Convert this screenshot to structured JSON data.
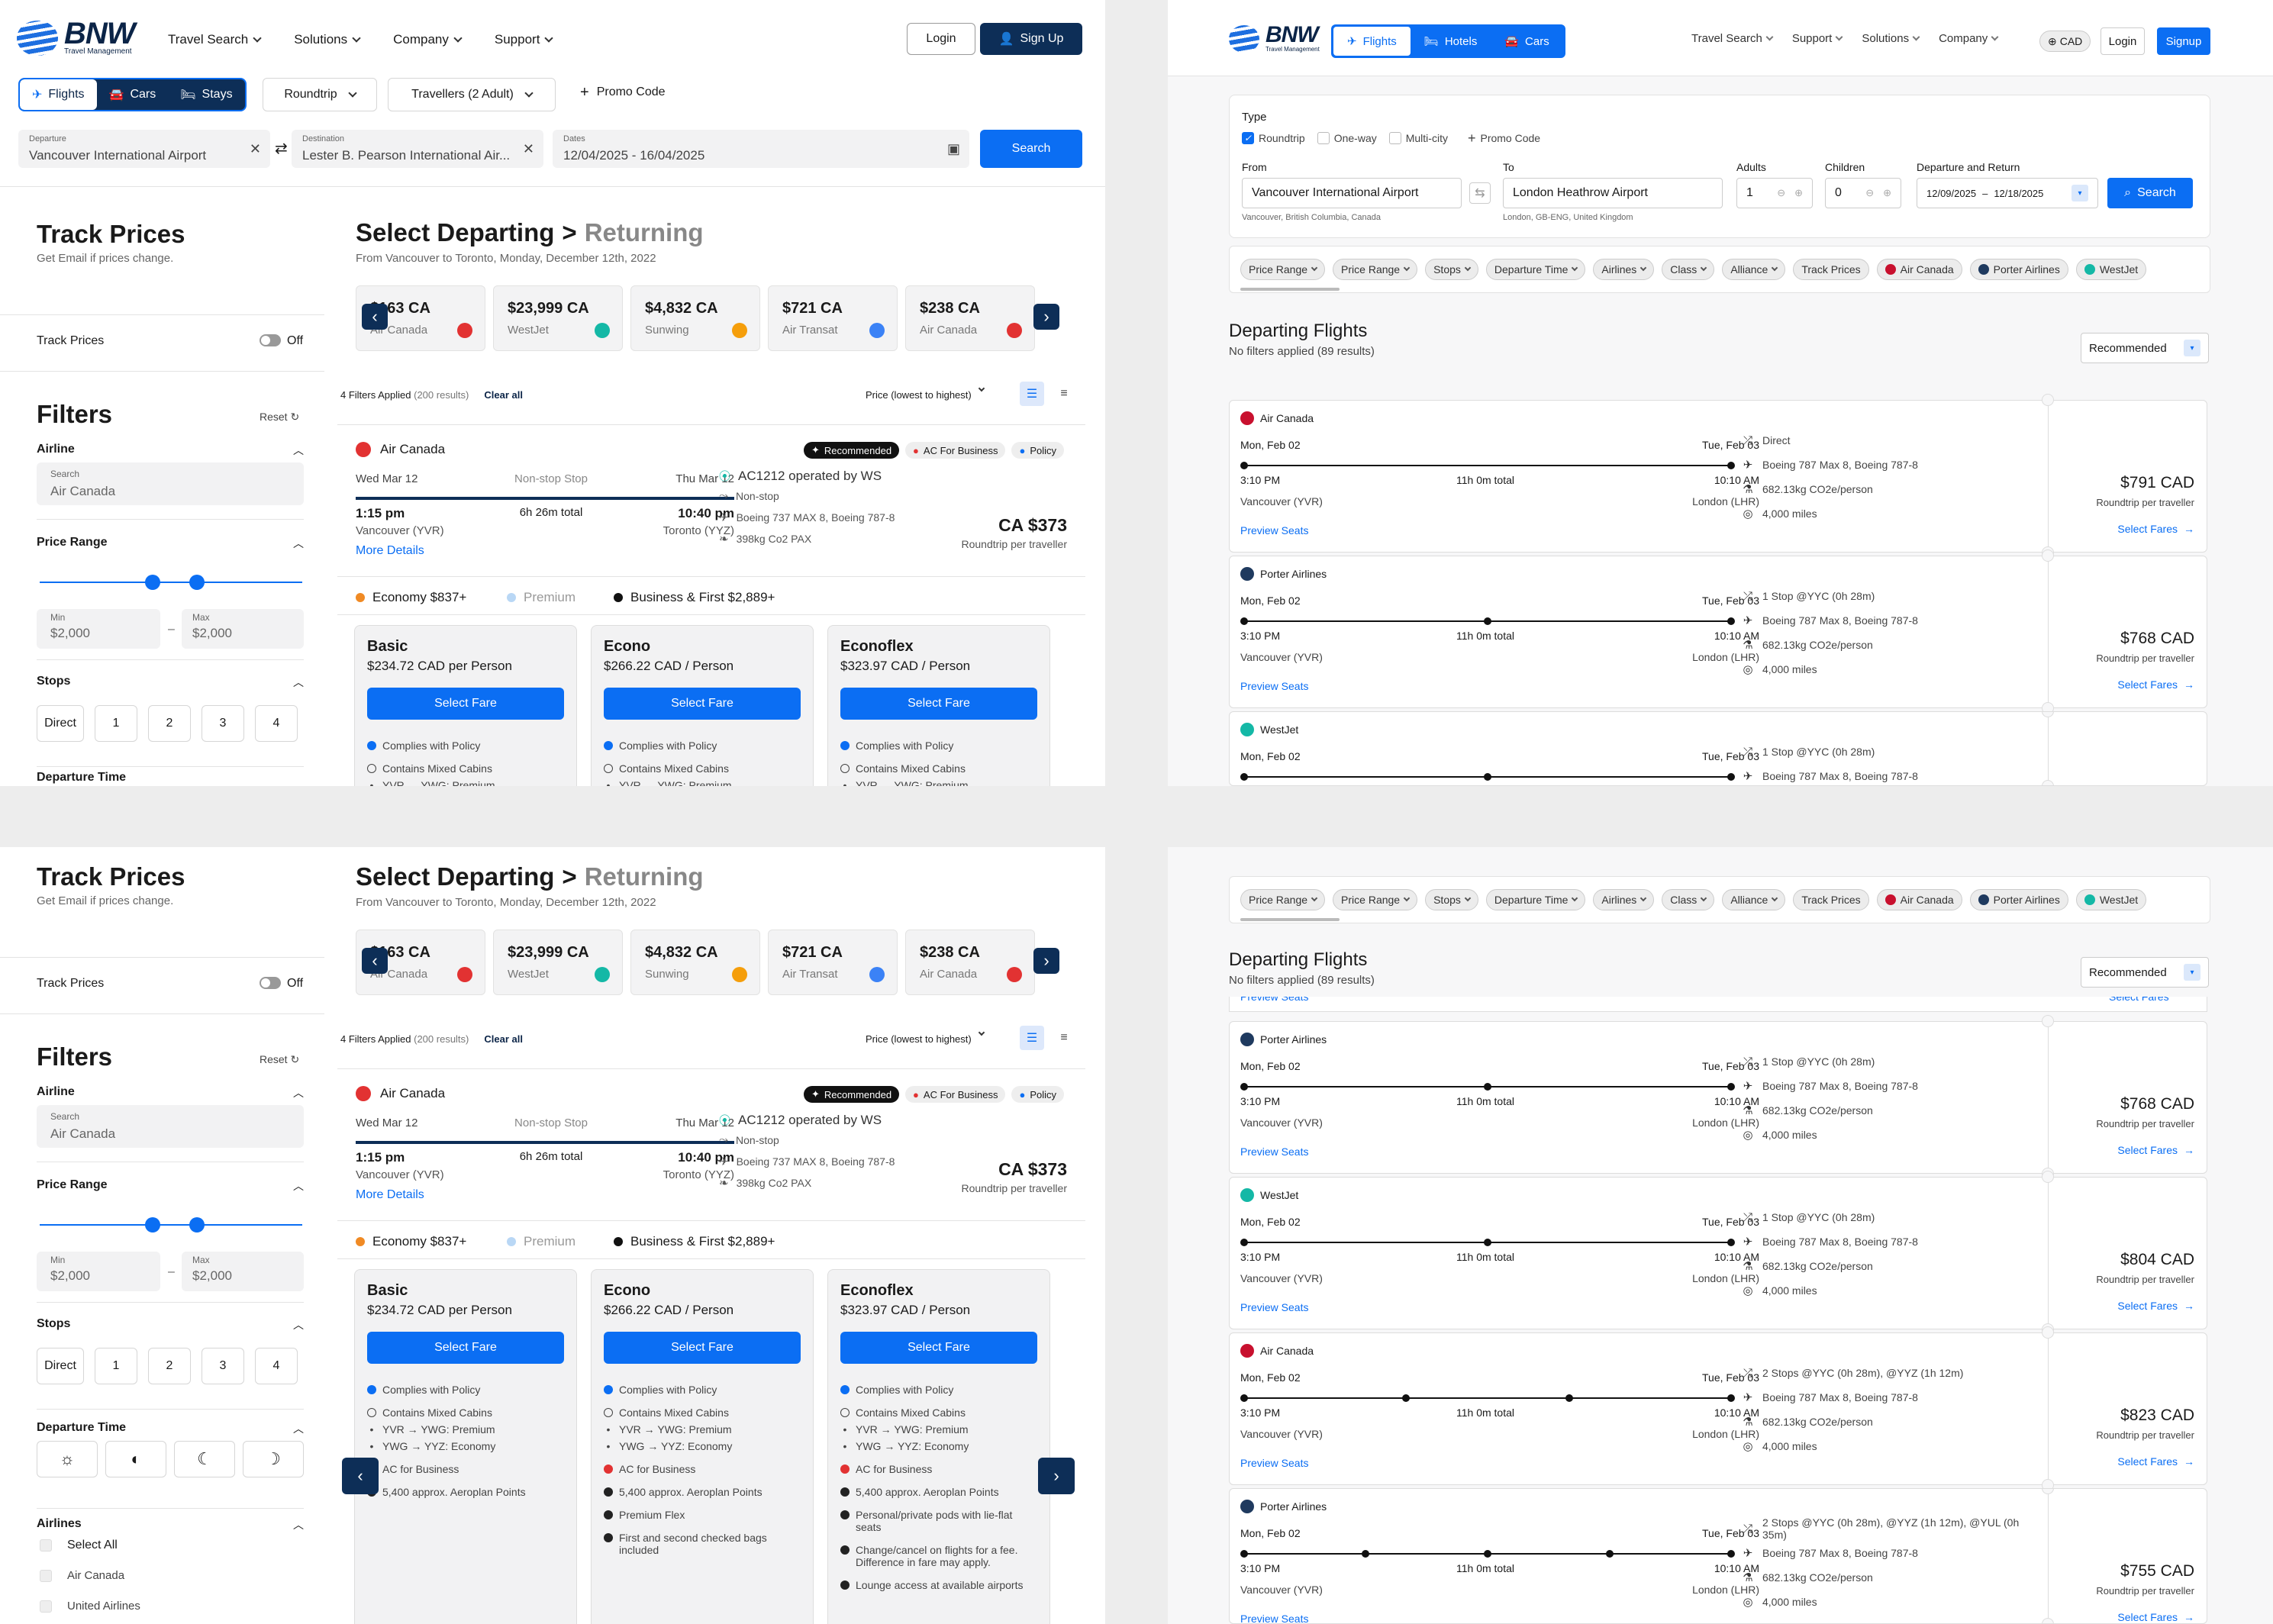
{
  "brand": {
    "name": "BNW",
    "sub": "Travel Management"
  },
  "left": {
    "nav": [
      "Travel Search",
      "Solutions",
      "Company",
      "Support"
    ],
    "login": "Login",
    "signup": "Sign Up",
    "modes": [
      "Flights",
      "Cars",
      "Stays"
    ],
    "trip_type": "Roundtrip",
    "travellers": "Travellers (2 Adult)",
    "promo": "Promo Code",
    "departure_label": "Departure",
    "departure": "Vancouver International Airport",
    "destination_label": "Destination",
    "destination": "Lester B. Pearson International Air...",
    "dates_label": "Dates",
    "dates": "12/04/2025 - 16/04/2025",
    "search": "Search",
    "track": {
      "title": "Track Prices",
      "sub": "Get Email if prices change.",
      "toggle_label": "Track Prices",
      "toggle_state": "Off"
    },
    "filters": {
      "title": "Filters",
      "reset": "Reset",
      "airline": "Airline",
      "search_label": "Search",
      "search_value": "Air Canada",
      "price_range": "Price Range",
      "min_label": "Min",
      "min": "$2,000",
      "max_label": "Max",
      "max": "$2,000",
      "stops": "Stops",
      "stop_opts": [
        "Direct",
        "1",
        "2",
        "3",
        "4"
      ],
      "departure_time": "Departure Time",
      "airlines": "Airlines",
      "airline_opts": [
        "Select All",
        "Air Canada",
        "United Airlines"
      ]
    },
    "heading": {
      "select": "Select Departing",
      "sep": ">",
      "returning": "Returning",
      "sub": "From Vancouver to Toronto, Monday, December 12th, 2022"
    },
    "price_cards": [
      {
        "price": "$163 CA",
        "airline": "Air Canada",
        "color": "#e23232"
      },
      {
        "price": "$23,999 CA",
        "airline": "WestJet",
        "color": "#14b8a6"
      },
      {
        "price": "$4,832 CA",
        "airline": "Sunwing",
        "color": "#f59e0b"
      },
      {
        "price": "$721 CA",
        "airline": "Air Transat",
        "color": "#3b82f6"
      },
      {
        "price": "$238 CA",
        "airline": "Air Canada",
        "color": "#e23232"
      }
    ],
    "results": {
      "applied": "4 Filters Applied",
      "count": "(200 results)",
      "clear": "Clear all",
      "sort": "Price (lowest to highest)"
    },
    "card": {
      "airline": "Air Canada",
      "badges": [
        "Recommended",
        "AC For Business",
        "Policy"
      ],
      "dep_date": "Wed Mar 12",
      "stop_type": "Non-stop Stop",
      "arr_date": "Thu Mar 12",
      "dep_time": "1:15 pm",
      "duration": "6h 26m total",
      "arr_time": "10:40 pm",
      "dep_place": "Vancouver (YVR)",
      "arr_place": "Toronto (YYZ)",
      "more": "More Details",
      "operated": "AC1212 operated by WS",
      "nonstop": "Non-stop",
      "aircraft": "Boeing 737 MAX 8, Boeing 787-8",
      "co2": "398kg Co2 PAX",
      "price": "CA $373",
      "price_sub": "Roundtrip per traveller",
      "cabins": [
        {
          "label": "Economy $837+",
          "color": "#f08a24"
        },
        {
          "label": "Premium",
          "color": "#b9d7f5"
        },
        {
          "label": "Business & First $2,889+",
          "color": "#111"
        }
      ]
    },
    "fares": [
      {
        "name": "Basic",
        "price": "$234.72 CAD per Person",
        "btn": "Select Fare",
        "items": [
          {
            "t": "Complies with Policy",
            "c": "#0b6ef3"
          },
          {
            "t": "Contains Mixed Cabins",
            "c": "#fff"
          },
          {
            "t": "YVR → YWG: Premium",
            "c": "none"
          },
          {
            "t": "YWG → YYZ: Economy",
            "c": "none"
          },
          {
            "t": "AC for Business",
            "c": "#e23232"
          },
          {
            "t": "5,400 approx. Aeroplan Points",
            "c": "#222"
          }
        ]
      },
      {
        "name": "Econo",
        "price": "$266.22 CAD / Person",
        "btn": "Select Fare",
        "items": [
          {
            "t": "Complies with Policy",
            "c": "#0b6ef3"
          },
          {
            "t": "Contains Mixed Cabins",
            "c": "#fff"
          },
          {
            "t": "YVR → YWG: Premium",
            "c": "none"
          },
          {
            "t": "YWG → YYZ: Economy",
            "c": "none"
          },
          {
            "t": "AC for Business",
            "c": "#e23232"
          },
          {
            "t": "5,400 approx. Aeroplan Points",
            "c": "#222"
          },
          {
            "t": "Premium Flex",
            "c": "#222"
          },
          {
            "t": "First and second checked bags included",
            "c": "#222"
          }
        ]
      },
      {
        "name": "Econoflex",
        "price": "$323.97 CAD / Person",
        "btn": "Select Fare",
        "items": [
          {
            "t": "Complies with Policy",
            "c": "#0b6ef3"
          },
          {
            "t": "Contains Mixed Cabins",
            "c": "#fff"
          },
          {
            "t": "YVR → YWG: Premium",
            "c": "none"
          },
          {
            "t": "YWG → YYZ: Economy",
            "c": "none"
          },
          {
            "t": "AC for Business",
            "c": "#e23232"
          },
          {
            "t": "5,400 approx. Aeroplan Points",
            "c": "#222"
          },
          {
            "t": "Personal/private pods with lie-flat seats",
            "c": "#222"
          },
          {
            "t": "Change/cancel on flights for a fee. Difference in fare may apply.",
            "c": "#222"
          },
          {
            "t": "Lounge access at available airports",
            "c": "#222"
          }
        ]
      }
    ]
  },
  "right": {
    "modes": [
      "Flights",
      "Hotels",
      "Cars"
    ],
    "nav": [
      "Travel Search",
      "Support",
      "Solutions",
      "Company"
    ],
    "currency": "CAD",
    "login": "Login",
    "signup": "Signup",
    "type_label": "Type",
    "types": [
      "Roundtrip",
      "One-way",
      "Multi-city"
    ],
    "promo": "Promo Code",
    "from_label": "From",
    "from": "Vancouver International Airport",
    "from_sub": "Vancouver, British Columbia, Canada",
    "to_label": "To",
    "to": "London Heathrow Airport",
    "to_sub": "London, GB-ENG, United Kingdom",
    "adults_label": "Adults",
    "adults": "1",
    "children_label": "Children",
    "children": "0",
    "dates_label": "Departure and Return",
    "date_from": "12/09/2025",
    "date_to": "12/18/2025",
    "search": "Search",
    "chips": [
      "Price Range",
      "Price Range",
      "Stops",
      "Departure Time",
      "Airlines",
      "Class",
      "Alliance"
    ],
    "track": "Track Prices",
    "airline_chips": [
      "Air Canada",
      "Porter Airlines",
      "WestJet"
    ],
    "heading": "Departing Flights",
    "sub": "No filters applied (89 results)",
    "sort": "Recommended",
    "flights_top": [
      {
        "airline": "Air Canada",
        "color": "#c8102e",
        "stops": "Direct",
        "dots": 0,
        "price": "$791 CAD"
      },
      {
        "airline": "Porter Airlines",
        "color": "#1f3a5f",
        "stops": "1 Stop @YYC (0h 28m)",
        "dots": 1,
        "price": "$768 CAD"
      },
      {
        "airline": "WestJet",
        "color": "#14b8a6",
        "stops": "1 Stop @YYC (0h 28m)",
        "dots": 1,
        "price": ""
      }
    ],
    "flights_bottom": [
      {
        "airline": "Porter Airlines",
        "color": "#1f3a5f",
        "stops": "1 Stop @YYC (0h 28m)",
        "dots": 1,
        "price": "$768 CAD"
      },
      {
        "airline": "WestJet",
        "color": "#14b8a6",
        "stops": "1 Stop @YYC (0h 28m)",
        "dots": 1,
        "price": "$804 CAD"
      },
      {
        "airline": "Air Canada",
        "color": "#c8102e",
        "stops": "2 Stops @YYC (0h 28m), @YYZ (1h 12m)",
        "dots": 2,
        "price": "$823 CAD"
      },
      {
        "airline": "Porter Airlines",
        "color": "#1f3a5f",
        "stops": "2 Stops @YYC (0h 28m), @YYZ (1h 12m), @YUL (0h 35m)",
        "dots": 3,
        "price": "$755 CAD"
      }
    ],
    "flight_common": {
      "dep_date": "Mon, Feb 02",
      "arr_date": "Tue, Feb 03",
      "dep_time": "3:10 PM",
      "duration": "11h 0m total",
      "arr_time": "10:10 AM",
      "dep_place": "Vancouver (YVR)",
      "arr_place": "London (LHR)",
      "preview": "Preview Seats",
      "aircraft": "Boeing 787 Max 8, Boeing 787-8",
      "co2": "682.13kg CO2e/person",
      "miles": "4,000 miles",
      "price_sub": "Roundtrip per traveller",
      "select": "Select Fares"
    },
    "partial": {
      "preview": "Preview Seats",
      "select": "Select Fares"
    }
  }
}
